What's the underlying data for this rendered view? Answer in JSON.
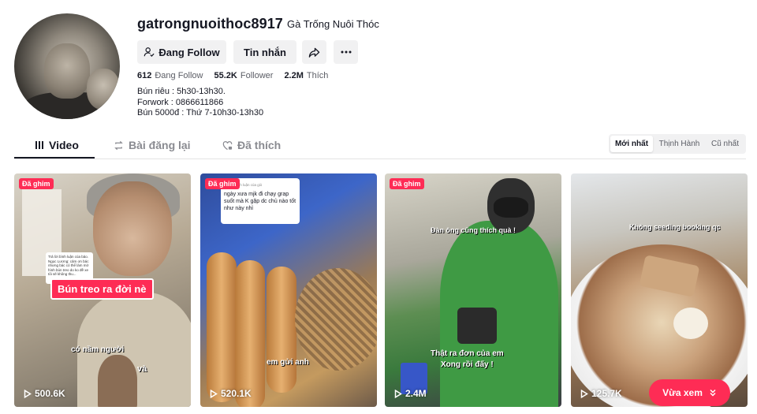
{
  "profile": {
    "username": "gatrongnuoithoc8917",
    "nickname": "Gà Trống Nuôi Thóc",
    "follow_label": "Đang Follow",
    "message_label": "Tin nhắn",
    "stats": {
      "following_count": "612",
      "following_label": "Đang Follow",
      "followers_count": "55.2K",
      "followers_label": "Follower",
      "likes_count": "2.2M",
      "likes_label": "Thích"
    },
    "bio": [
      "Bún riêu : 5h30-13h30.",
      "Forwork : 0866611866",
      "Bún 5000đ : Thứ 7-10h30-13h30"
    ]
  },
  "tabs": [
    {
      "label": "Video",
      "active": true
    },
    {
      "label": "Bài đăng lại",
      "active": false
    },
    {
      "label": "Đã thích",
      "active": false
    }
  ],
  "sort": [
    "Mới nhất",
    "Thịnh Hành",
    "Cũ nhất"
  ],
  "videos": [
    {
      "pinned": "Đã ghim",
      "views": "500.6K",
      "caption": "Bún treo ra đời nè",
      "sub1": "có nầm người",
      "sub2": "và",
      "comment": "Trả lời bình luận của bảo. Ngọc Lương: cảm ơn bác nhưng bác có thể làm mở hình bún treo do ko đề xe tôi sẽ không thu..."
    },
    {
      "pinned": "Đã ghim",
      "views": "520.1K",
      "comment_meta": "Trả lời bình luận của giò",
      "comment": "ngày xưa mjk đi chạy grap suốt mà K gặp dc chủ nào tốt như này nhỉ",
      "sub": "em gửi anh"
    },
    {
      "pinned": "Đã ghim",
      "views": "2.4M",
      "cap1": "Đàn ông cũng thích quà !",
      "cap2a": "Thật ra đơn của em",
      "cap2b": "Xong rồi đấy !"
    },
    {
      "views": "125.7K",
      "cap": "Không seeding booking qc",
      "watch_more": "Vừa xem"
    }
  ],
  "colors": {
    "accent": "#fe2c55",
    "text": "#161823",
    "muted": "#8a8b91",
    "button_bg": "#f1f1f2"
  }
}
